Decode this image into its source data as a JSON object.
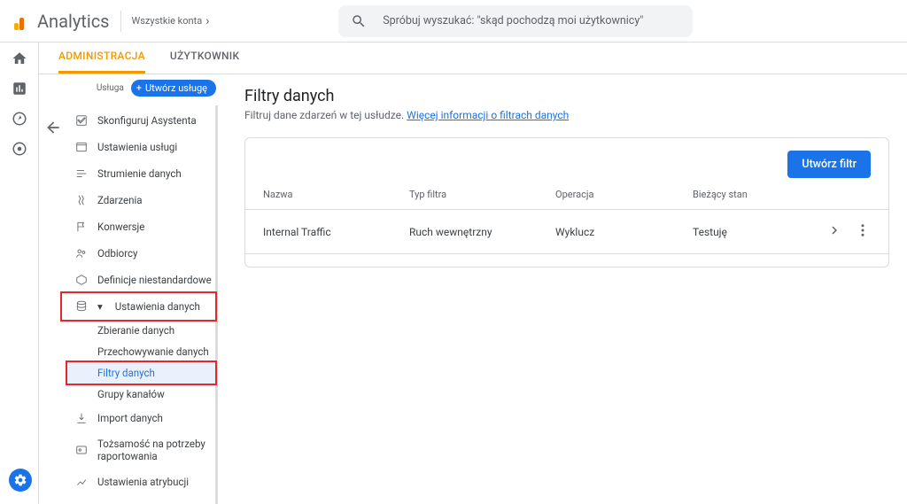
{
  "header": {
    "logo": "Analytics",
    "accounts": "Wszystkie konta",
    "search_placeholder": "Spróbuj wyszukać: \"skąd pochodzą moi użytkownicy\""
  },
  "tabs": {
    "admin": "ADMINISTRACJA",
    "user": "UŻYTKOWNIK"
  },
  "sidebar": {
    "property_label": "Usługa",
    "create_button": "Utwórz usługę",
    "items": {
      "assistant": "Skonfiguruj Asystenta",
      "settings": "Ustawienia usługi",
      "streams": "Strumienie danych",
      "events": "Zdarzenia",
      "conversions": "Konwersje",
      "audiences": "Odbiorcy",
      "custom": "Definicje niestandardowe",
      "data_settings": "Ustawienia danych",
      "sub": {
        "collection": "Zbieranie danych",
        "retention": "Przechowywanie danych",
        "filters": "Filtry danych",
        "channels": "Grupy kanałów"
      },
      "import": "Import danych",
      "identity": "Tożsamość na potrzeby raportowania",
      "attribution": "Ustawienia atrybucji"
    }
  },
  "panel": {
    "title": "Filtry danych",
    "subtitle_pre": "Filtruj dane zdarzeń w tej usłudze. ",
    "subtitle_link": "Więcej informacji o filtrach danych",
    "create_filter": "Utwórz filtr",
    "columns": {
      "name": "Nazwa",
      "type": "Typ filtra",
      "op": "Operacja",
      "state": "Bieżący stan"
    },
    "rows": [
      {
        "name": "Internal Traffic",
        "type": "Ruch wewnętrzny",
        "op": "Wyklucz",
        "state": "Testuję"
      }
    ]
  }
}
